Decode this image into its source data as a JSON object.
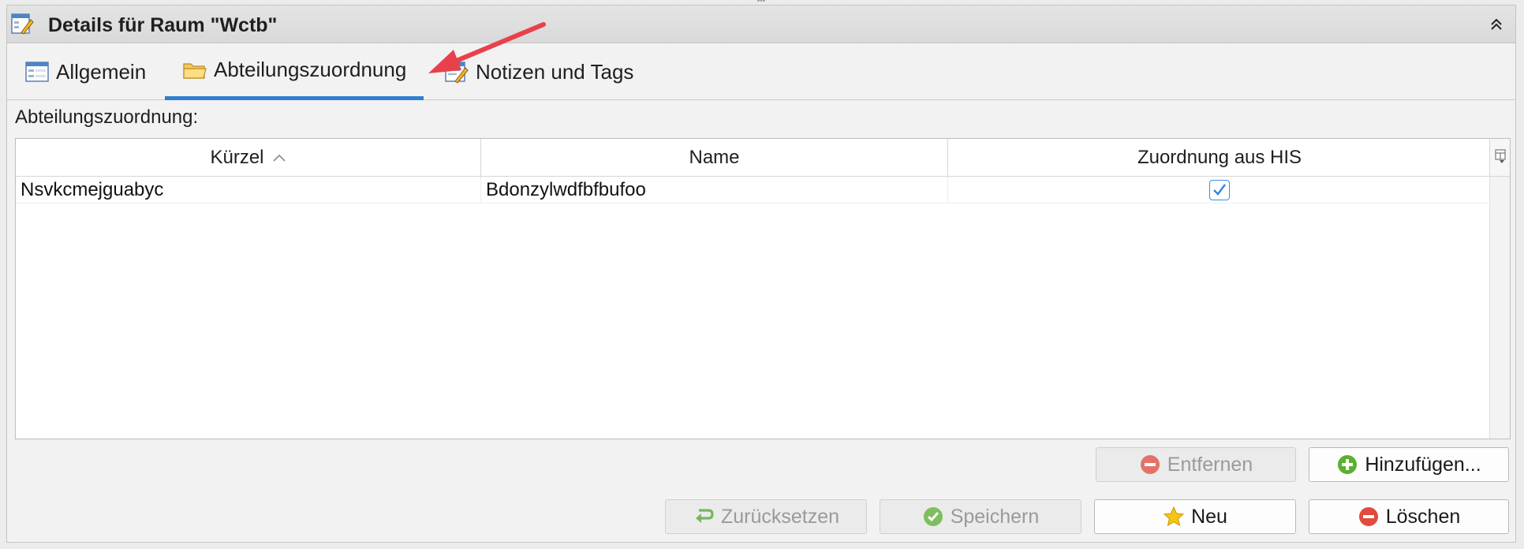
{
  "panel": {
    "title": "Details für Raum \"Wctb\"",
    "title_icon": "form-edit-icon",
    "collapse_icon": "chevron-up-double-icon"
  },
  "tabs": [
    {
      "label": "Allgemein",
      "icon": "form-icon",
      "active": false
    },
    {
      "label": "Abteilungszuordnung",
      "icon": "folder-icon",
      "active": true
    },
    {
      "label": "Notizen und Tags",
      "icon": "notes-edit-icon",
      "active": false
    }
  ],
  "section": {
    "label": "Abteilungszuordnung:"
  },
  "table": {
    "columns": [
      "Kürzel",
      "Name",
      "Zuordnung aus HIS"
    ],
    "sorted_column": "Kürzel",
    "sort_direction": "ascending",
    "rows": [
      {
        "kuerzel": "Nsvkcmejguabyc",
        "name": "Bdonzylwdfbfbufoo",
        "his": true
      }
    ]
  },
  "buttons": {
    "entfernen": "Entfernen",
    "hinzufuegen": "Hinzufügen...",
    "zuruecksetzen": "Zurücksetzen",
    "speichern": "Speichern",
    "neu": "Neu",
    "loeschen": "Löschen"
  },
  "colors": {
    "accent": "#2e7fcf",
    "arrow": "#e8414b",
    "remove": "#e14b3c",
    "add": "#5bb030",
    "star": "#f5c518"
  }
}
